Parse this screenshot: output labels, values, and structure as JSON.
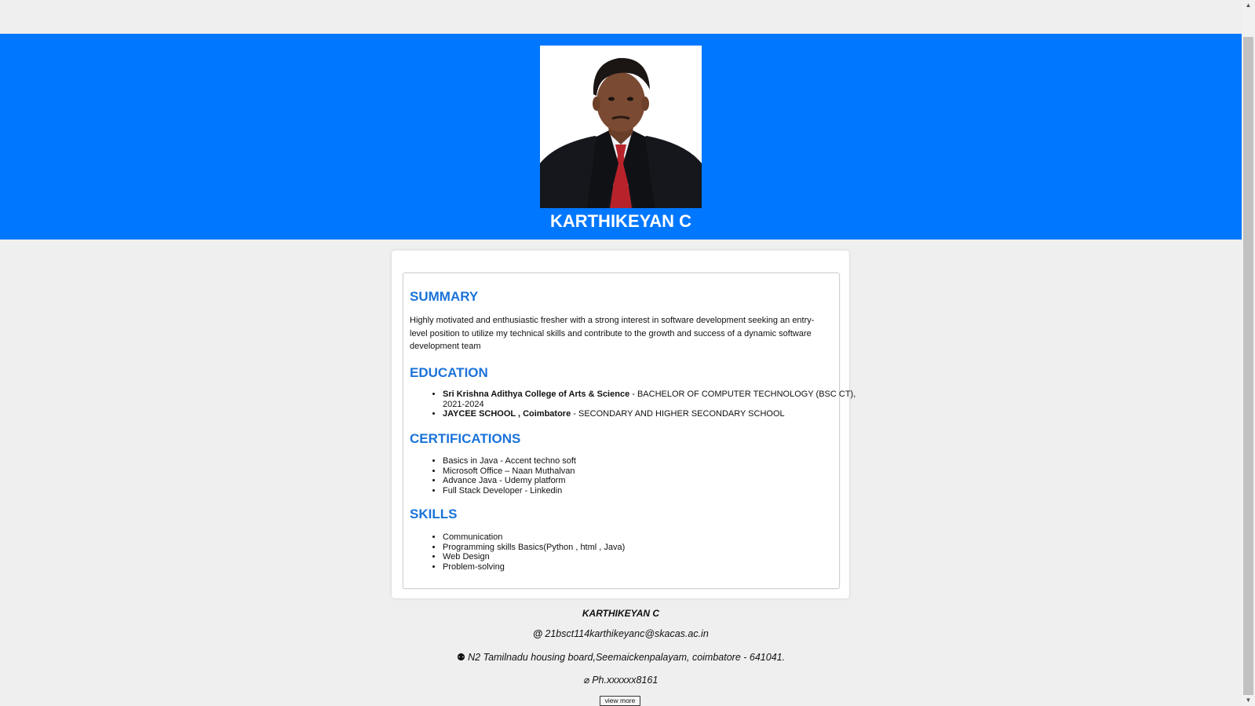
{
  "header": {
    "photo_alt": "profile photo",
    "name": "KARTHIKEYAN C",
    "bg_color": "#0077ff"
  },
  "summary": {
    "heading": "SUMMARY",
    "text": "Highly motivated and enthusiastic fresher with a strong interest in software development seeking an entry-level position to utilize my technical skills and contribute to the growth and success of a dynamic software development team"
  },
  "education": {
    "heading": "EDUCATION",
    "items": [
      {
        "institution": "Sri Krishna Adithya College of Arts & Science",
        "detail": " - BACHELOR OF COMPUTER TECHNOLOGY (BSC CT), 2021-2024"
      },
      {
        "institution": "JAYCEE SCHOOL , Coimbatore",
        "detail": " - SECONDARY AND HIGHER SECONDARY SCHOOL"
      }
    ]
  },
  "certifications": {
    "heading": "CERTIFICATIONS",
    "items": [
      "Basics in Java - Accent techno soft",
      "Microsoft Office – Naan Muthalvan",
      "Advance Java - Udemy platform",
      "Full Stack Developer - Linkedin"
    ]
  },
  "skills": {
    "heading": "SKILLS",
    "items": [
      "Communication",
      "Programming skills Basics(Python , html , Java)",
      "Web Design",
      "Problem-solving"
    ]
  },
  "footer": {
    "name": "KARTHIKEYAN C",
    "email_icon": "@",
    "email": "21bsct114karthikeyanc@skacas.ac.in",
    "address_icon": "⚉",
    "address": "N2 Tamilnadu housing board,Seemaickenpalayam, coimbatore - 641041.",
    "phone_icon": "⌀",
    "phone": "Ph.xxxxxx8161",
    "view_more_label": "view more"
  },
  "colors": {
    "accent": "#1a73d9",
    "page_bg": "#efefef"
  }
}
